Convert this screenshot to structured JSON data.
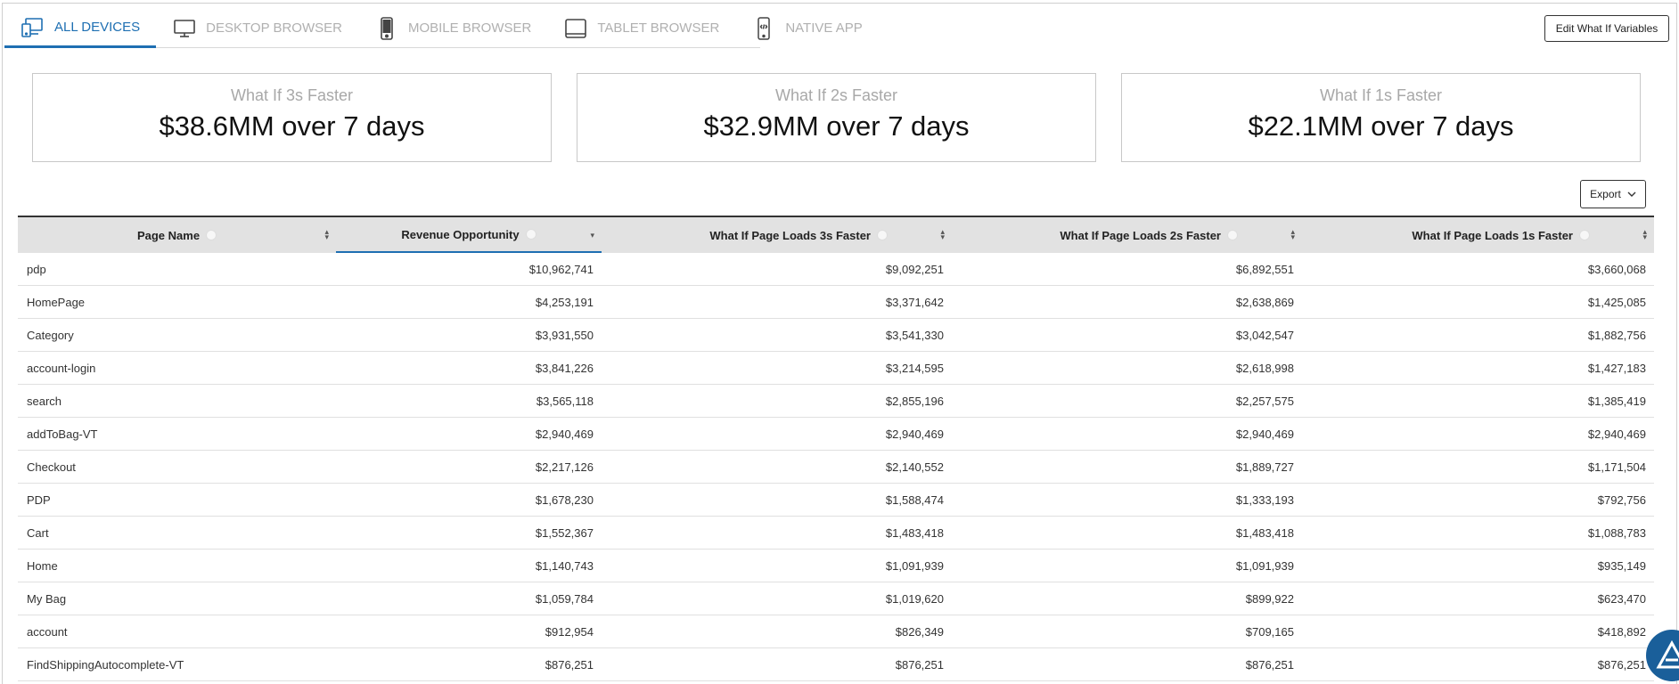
{
  "tabs": [
    {
      "label": "ALL DEVICES",
      "icon": "all-devices-icon",
      "active": true
    },
    {
      "label": "DESKTOP BROWSER",
      "icon": "desktop-icon",
      "active": false
    },
    {
      "label": "MOBILE BROWSER",
      "icon": "mobile-icon",
      "active": false
    },
    {
      "label": "TABLET BROWSER",
      "icon": "tablet-icon",
      "active": false
    },
    {
      "label": "NATIVE APP",
      "icon": "native-app-icon",
      "active": false
    }
  ],
  "toolbar": {
    "edit_label": "Edit What If Variables",
    "export_label": "Export"
  },
  "cards": [
    {
      "label": "What If 3s Faster",
      "value": "$38.6MM over 7 days"
    },
    {
      "label": "What If 2s Faster",
      "value": "$32.9MM over 7 days"
    },
    {
      "label": "What If 1s Faster",
      "value": "$22.1MM over 7 days"
    }
  ],
  "table": {
    "columns": [
      "Page Name",
      "Revenue Opportunity",
      "What If Page Loads 3s Faster",
      "What If Page Loads 2s Faster",
      "What If Page Loads 1s Faster"
    ],
    "rows": [
      [
        "pdp",
        "$10,962,741",
        "$9,092,251",
        "$6,892,551",
        "$3,660,068"
      ],
      [
        "HomePage",
        "$4,253,191",
        "$3,371,642",
        "$2,638,869",
        "$1,425,085"
      ],
      [
        "Category",
        "$3,931,550",
        "$3,541,330",
        "$3,042,547",
        "$1,882,756"
      ],
      [
        "account-login",
        "$3,841,226",
        "$3,214,595",
        "$2,618,998",
        "$1,427,183"
      ],
      [
        "search",
        "$3,565,118",
        "$2,855,196",
        "$2,257,575",
        "$1,385,419"
      ],
      [
        "addToBag-VT",
        "$2,940,469",
        "$2,940,469",
        "$2,940,469",
        "$2,940,469"
      ],
      [
        "Checkout",
        "$2,217,126",
        "$2,140,552",
        "$1,889,727",
        "$1,171,504"
      ],
      [
        "PDP",
        "$1,678,230",
        "$1,588,474",
        "$1,333,193",
        "$792,756"
      ],
      [
        "Cart",
        "$1,552,367",
        "$1,483,418",
        "$1,483,418",
        "$1,088,783"
      ],
      [
        "Home",
        "$1,140,743",
        "$1,091,939",
        "$1,091,939",
        "$935,149"
      ],
      [
        "My Bag",
        "$1,059,784",
        "$1,019,620",
        "$899,922",
        "$623,470"
      ],
      [
        "account",
        "$912,954",
        "$826,349",
        "$709,165",
        "$418,892"
      ],
      [
        "FindShippingAutocomplete-VT",
        "$876,251",
        "$876,251",
        "$876,251",
        "$876,251"
      ]
    ]
  },
  "colors": {
    "accent": "#1e6fb2",
    "header_bg": "#e2e2e2"
  }
}
